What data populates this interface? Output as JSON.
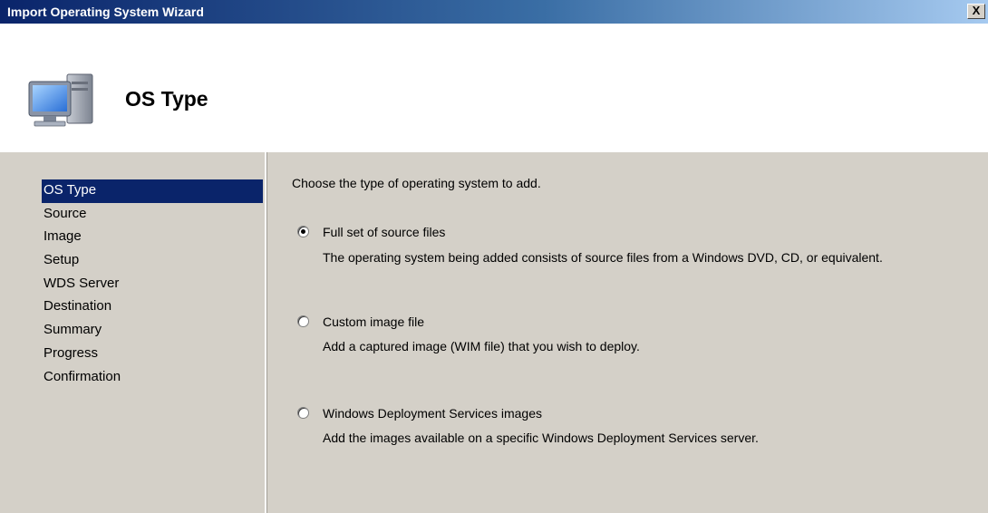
{
  "window": {
    "title": "Import Operating System Wizard",
    "close_label": "X"
  },
  "header": {
    "page_title": "OS Type",
    "icon": "computer-icon"
  },
  "nav": {
    "items": [
      {
        "label": "OS Type",
        "selected": true
      },
      {
        "label": "Source"
      },
      {
        "label": "Image"
      },
      {
        "label": "Setup"
      },
      {
        "label": "WDS Server"
      },
      {
        "label": "Destination"
      },
      {
        "label": "Summary"
      },
      {
        "label": "Progress"
      },
      {
        "label": "Confirmation"
      }
    ]
  },
  "content": {
    "instruction": "Choose the type of operating system to add.",
    "options": [
      {
        "label": "Full set of source files",
        "description": "The operating system being added consists of source files from a Windows DVD, CD, or equivalent.",
        "checked": true
      },
      {
        "label": "Custom image file",
        "description": "Add a captured image (WIM file) that you wish to deploy.",
        "checked": false
      },
      {
        "label": "Windows Deployment Services images",
        "description": "Add the images available on a specific Windows Deployment Services server.",
        "checked": false
      }
    ]
  },
  "colors": {
    "title_bar": "#0a246a",
    "dialog_face": "#d4d0c8",
    "selection": "#0a246a"
  }
}
